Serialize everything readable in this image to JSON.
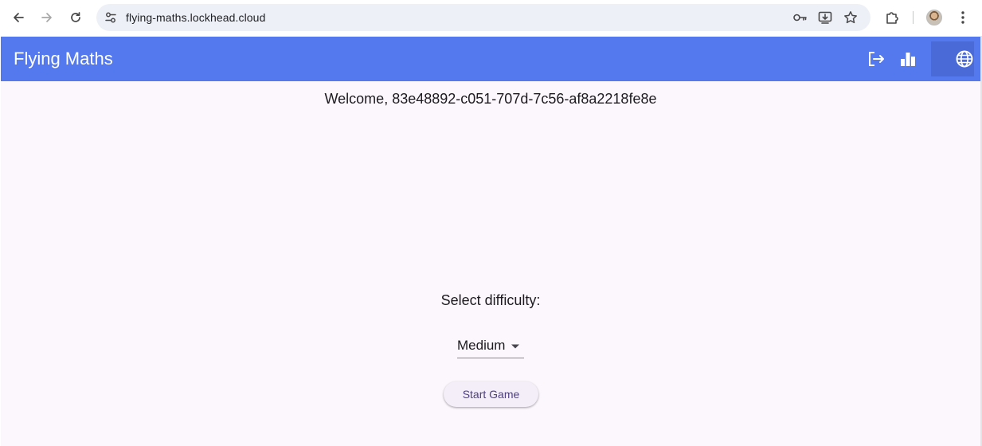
{
  "browser": {
    "url": "flying-maths.lockhead.cloud",
    "icons": [
      "back-arrow-icon",
      "forward-arrow-icon",
      "reload-icon",
      "site-settings-icon",
      "password-key-icon",
      "install-app-icon",
      "bookmark-star-icon",
      "extensions-puzzle-icon",
      "profile-avatar",
      "more-vert-icon"
    ]
  },
  "app": {
    "title": "Flying Maths",
    "header_icons": [
      "logout-icon",
      "leaderboard-icon",
      "language-globe-icon"
    ],
    "welcome": "Welcome, 83e48892-c051-707d-7c56-af8a2218fe8e",
    "difficulty_label": "Select difficulty:",
    "difficulty_value": "Medium",
    "start_button": "Start Game"
  },
  "colors": {
    "header": "#5479ee",
    "background": "#fcf6fd",
    "button_text": "#4d3e85"
  }
}
